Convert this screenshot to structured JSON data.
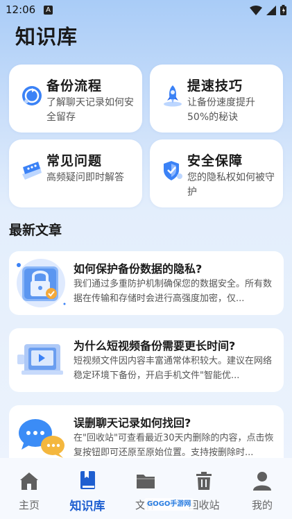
{
  "status_bar": {
    "time": "12:06",
    "notification_letter": "A"
  },
  "page": {
    "title": "知识库"
  },
  "cards": [
    {
      "title": "备份流程",
      "desc": "了解聊天记录如何安全留存",
      "icon": "sync-icon"
    },
    {
      "title": "提速技巧",
      "desc": "让备份速度提升50%的秘诀",
      "icon": "rocket-icon"
    },
    {
      "title": "常见问题",
      "desc": "高频疑问即时解答",
      "icon": "chat-bubble-icon"
    },
    {
      "title": "安全保障",
      "desc": "您的隐私权如何被守护",
      "icon": "shield-icon"
    }
  ],
  "section": {
    "latest_articles": "最新文章"
  },
  "articles": [
    {
      "title": "如何保护备份数据的隐私?",
      "desc": "我们通过多重防护机制确保您的数据安全。所有数据在传输和存储时会进行高强度加密，仅...",
      "icon": "padlock-icon"
    },
    {
      "title": "为什么短视频备份需要更长时间?",
      "desc": "短视频文件因内容丰富通常体积较大。建议在网络稳定环境下备份，开启手机文件\"智能优...",
      "icon": "video-icon"
    },
    {
      "title": "误删聊天记录如何找回?",
      "desc": "在\"回收站\"可查看最近30天内删除的内容，点击恢复按钮即可还原至原始位置。支持按删除时...",
      "icon": "chat-bubbles-icon"
    }
  ],
  "tabs": [
    {
      "label": "主页",
      "icon": "home-icon",
      "active": false
    },
    {
      "label": "知识库",
      "icon": "book-icon",
      "active": true
    },
    {
      "label": "文件",
      "icon": "folder-icon",
      "active": false
    },
    {
      "label": "回收站",
      "icon": "trash-icon",
      "active": false
    },
    {
      "label": "我的",
      "icon": "user-icon",
      "active": false
    }
  ],
  "watermark": {
    "text": "GOGO手游网"
  },
  "colors": {
    "accent": "#1f5fd0",
    "inactive": "#666666",
    "icon_gray": "#5f5f5f",
    "card_bg": "#ffffff"
  }
}
